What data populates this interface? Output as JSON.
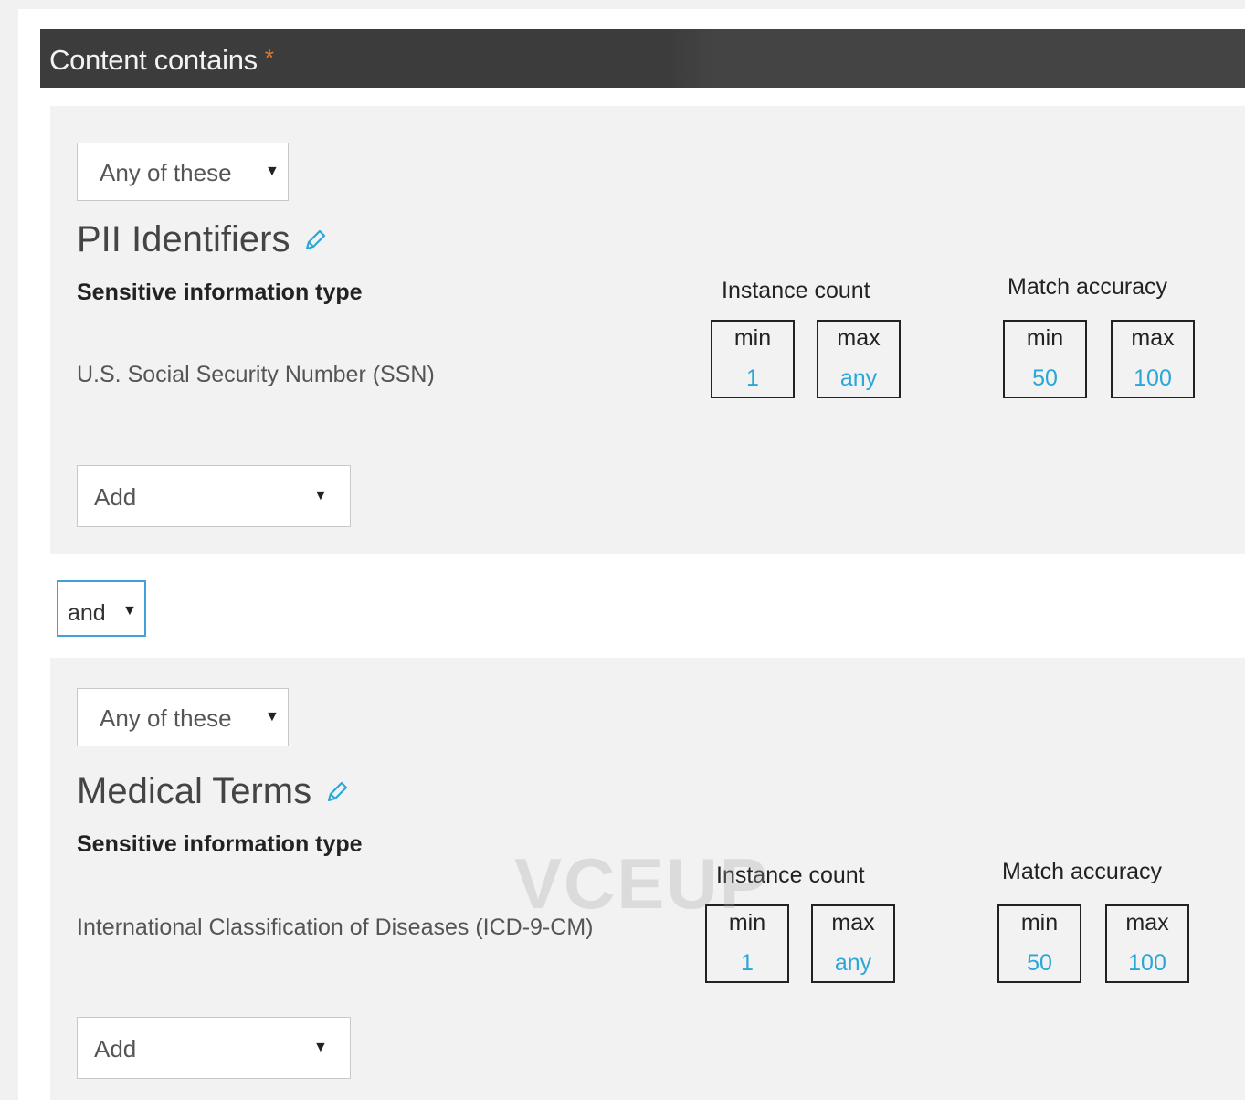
{
  "header": {
    "title": "Content contains",
    "required_marker": "*"
  },
  "groups": [
    {
      "match_mode": "Any of these",
      "title": "PII Identifiers",
      "column_label": "Sensitive information type",
      "instance_count_label": "Instance count",
      "match_accuracy_label": "Match accuracy",
      "type_name": "U.S. Social Security Number (SSN)",
      "instance_count": {
        "min_label": "min",
        "min": "1",
        "max_label": "max",
        "max": "any"
      },
      "match_accuracy": {
        "min_label": "min",
        "min": "50",
        "max_label": "max",
        "max": "100"
      },
      "add_label": "Add"
    },
    {
      "match_mode": "Any of these",
      "title": "Medical Terms",
      "column_label": "Sensitive information type",
      "instance_count_label": "Instance count",
      "match_accuracy_label": "Match accuracy",
      "type_name": "International Classification of Diseases (ICD-9-CM)",
      "instance_count": {
        "min_label": "min",
        "min": "1",
        "max_label": "max",
        "max": "any"
      },
      "match_accuracy": {
        "min_label": "min",
        "min": "50",
        "max_label": "max",
        "max": "100"
      },
      "add_label": "Add"
    }
  ],
  "operator": {
    "label": "and"
  },
  "watermark": "VCEUP",
  "colors": {
    "accent": "#2aa7d9",
    "header_bg": "#3c3c3c",
    "required": "#e8772e",
    "focus_border": "#41a1d8"
  }
}
